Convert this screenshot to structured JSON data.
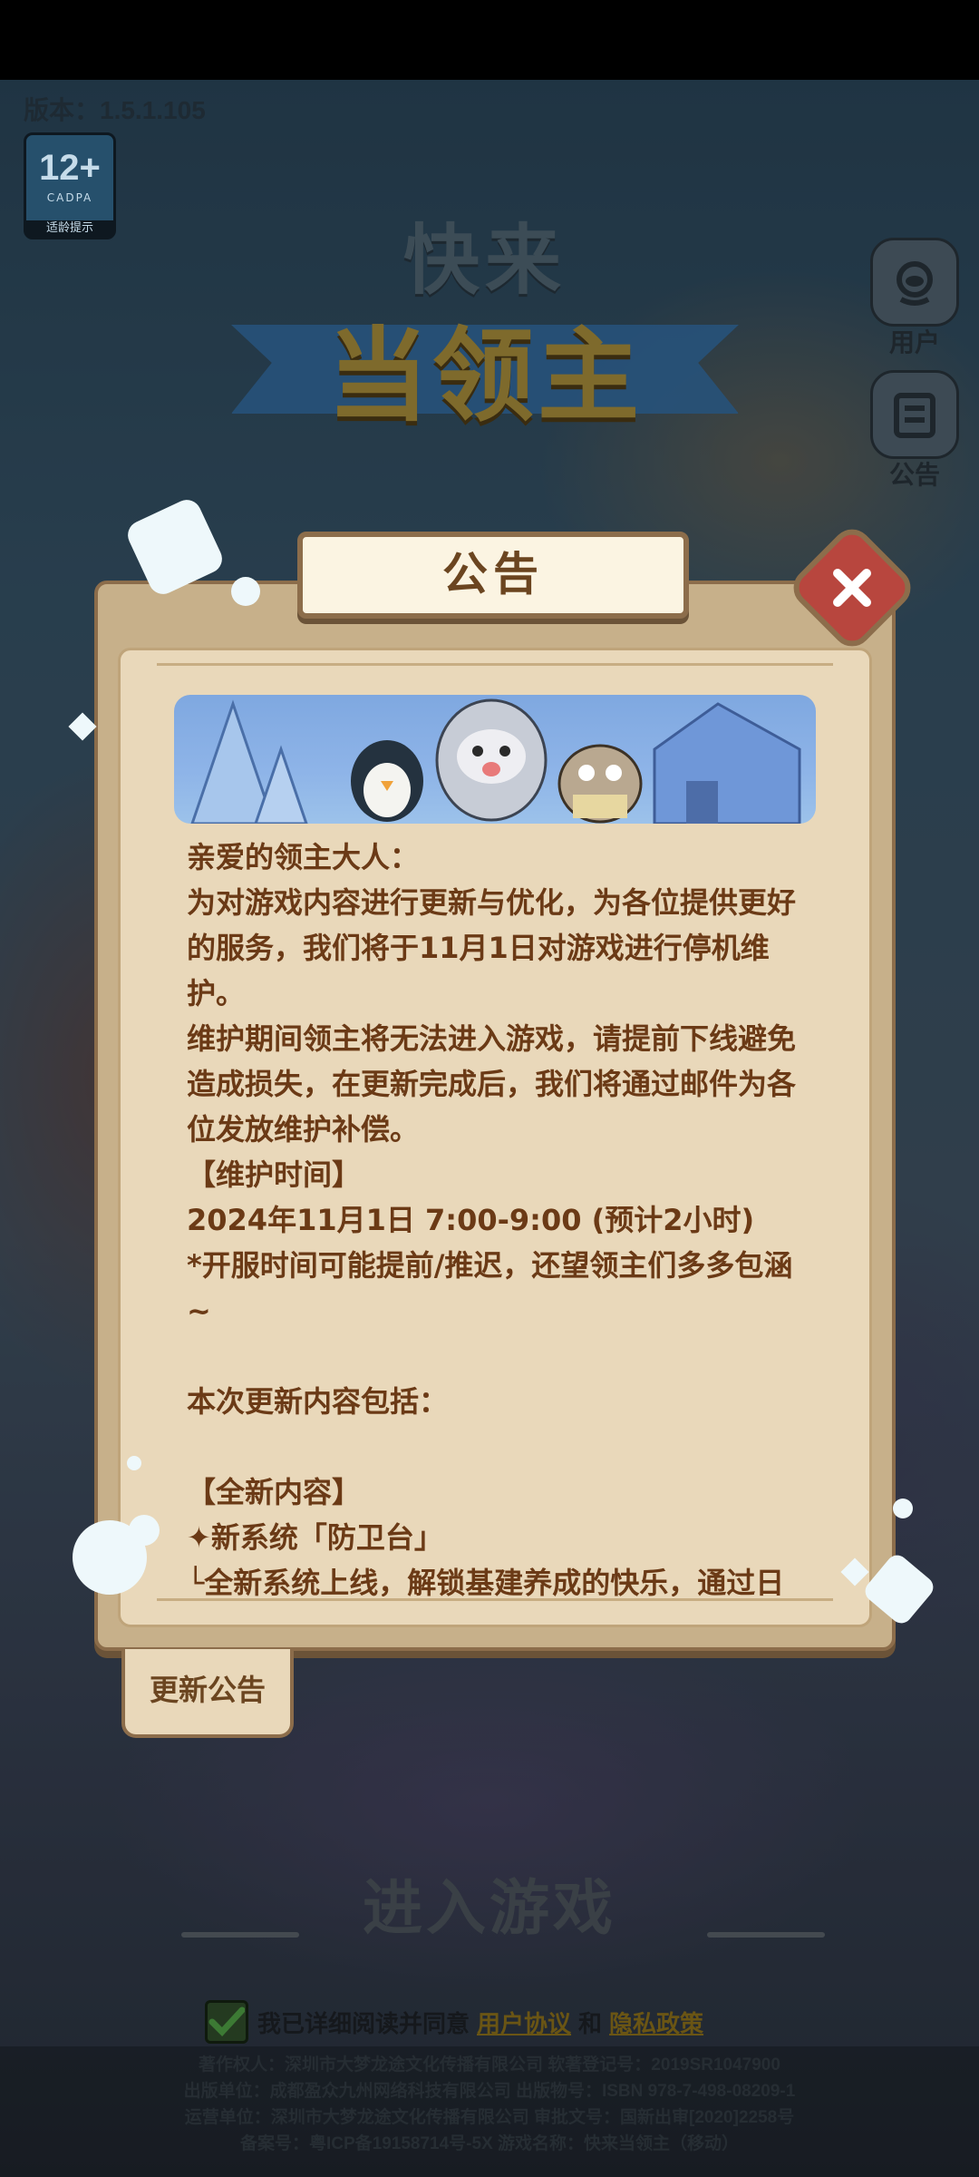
{
  "version_label": "版本：1.5.1.105",
  "age_badge": {
    "rating": "12+",
    "org": "CADPA",
    "tip": "适龄提示"
  },
  "logo": {
    "line1": "快来",
    "line2": "当领主"
  },
  "side_buttons": {
    "user": "用户",
    "notice": "公告"
  },
  "modal": {
    "title": "公告",
    "paragraphs": [
      "亲爱的领主大人：",
      "为对游戏内容进行更新与优化，为各位提供更好的服务，我们将于11月1日对游戏进行停机维护。",
      "维护期间领主将无法进入游戏，请提前下线避免造成损失，在更新完成后，我们将通过邮件为各位发放维护补偿。",
      "【维护时间】",
      "2024年11月1日 7:00-9:00 (预计2小时)",
      "*开服时间可能提前/推迟，还望领主们多多包涵~",
      "",
      "本次更新内容包括：",
      "",
      "【全新内容】",
      "✦新系统「防卫台」",
      "└全新系统上线，解锁基建养成的快乐，通过日常作战即可获得防卫台养成材料「洁白石英」，"
    ]
  },
  "update_tab_label": "更新公告",
  "enter_game_label": "进入游戏",
  "agreement": {
    "text": "我已详细阅读并同意",
    "user_agreement": "用户协议",
    "and": "和",
    "privacy_policy": "隐私政策"
  },
  "footer_lines": [
    "著作权人：深圳市大梦龙途文化传播有限公司  软著登记号：2019SR1047900",
    "出版单位：成都盈众九州网络科技有限公司  出版物号：ISBN 978-7-498-08209-1",
    "运营单位：深圳市大梦龙途文化传播有限公司  审批文号：国新出审[2020]2258号",
    "备案号：粤ICP备19158714号-5X  游戏名称：快来当领主（移动）"
  ],
  "colors": {
    "modal_bg": "#e9d8ba",
    "text_brown": "#6b3a16",
    "close_red": "#b8463e",
    "frame": "#8c6d4b"
  }
}
